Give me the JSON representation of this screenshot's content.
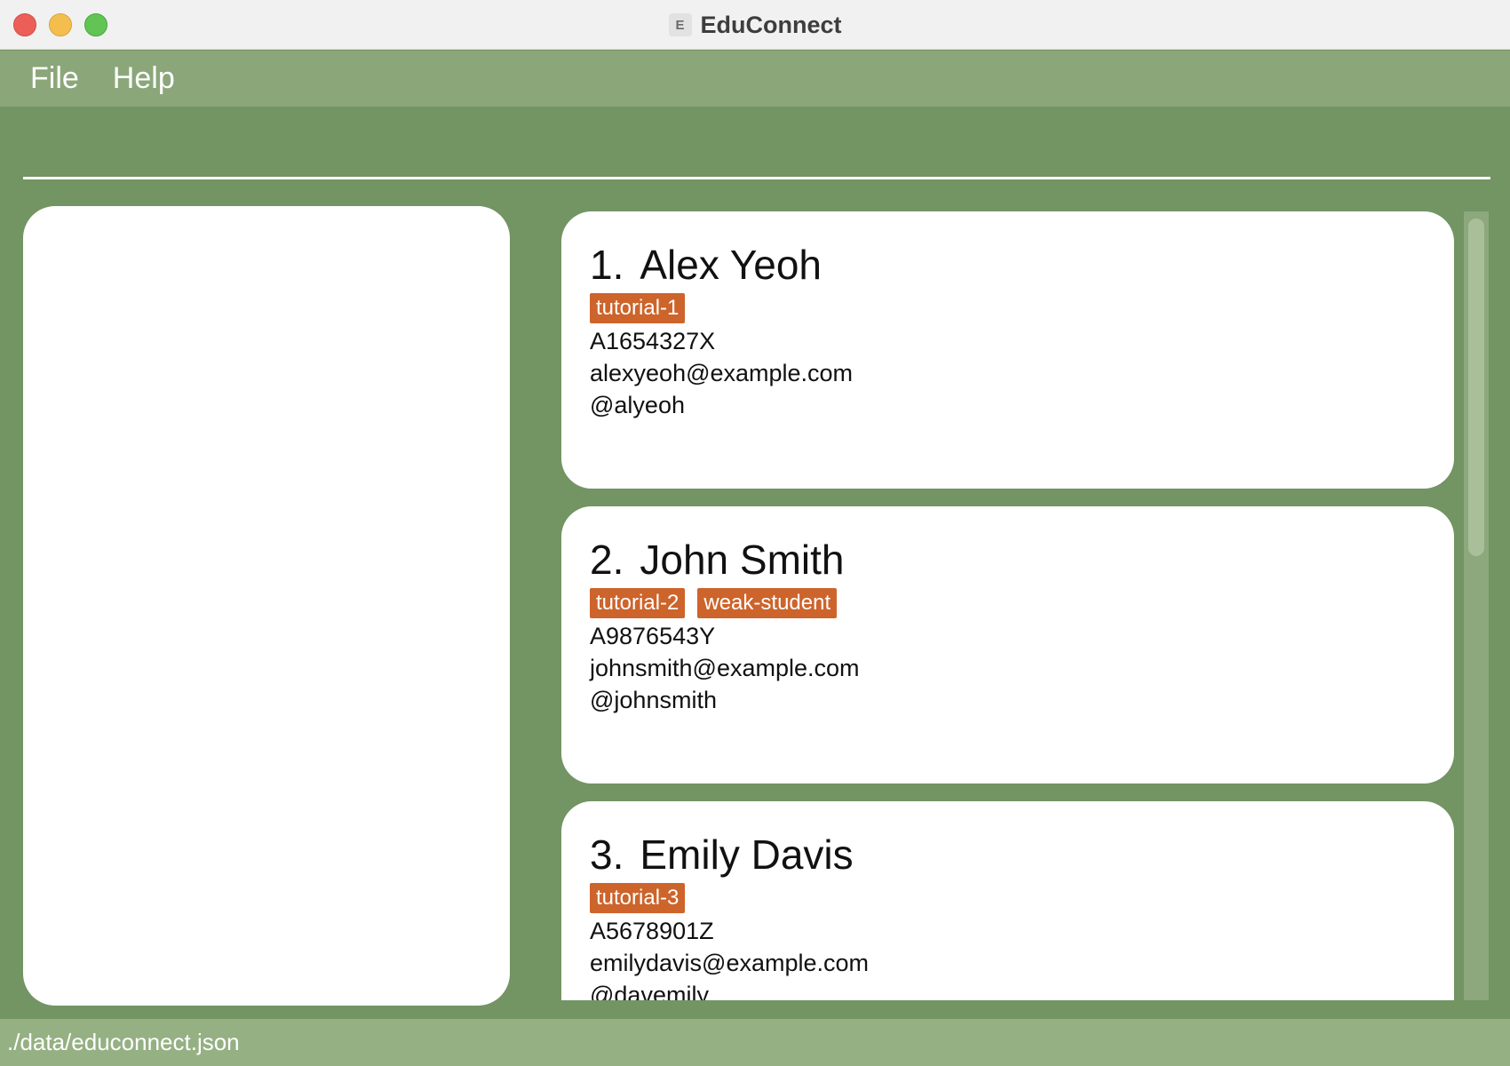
{
  "window": {
    "title": "EduConnect",
    "app_icon": "educonnect-icon"
  },
  "menu": {
    "file_label": "File",
    "help_label": "Help"
  },
  "command": {
    "value": "",
    "placeholder": ""
  },
  "result": {
    "text": ""
  },
  "persons": [
    {
      "index": "1.",
      "name": "Alex Yeoh",
      "tags": [
        "tutorial-1"
      ],
      "student_id": "A1654327X",
      "email": "alexyeoh@example.com",
      "telegram": "@alyeoh"
    },
    {
      "index": "2.",
      "name": "John Smith",
      "tags": [
        "tutorial-2",
        "weak-student"
      ],
      "student_id": "A9876543Y",
      "email": "johnsmith@example.com",
      "telegram": "@johnsmith"
    },
    {
      "index": "3.",
      "name": "Emily Davis",
      "tags": [
        "tutorial-3"
      ],
      "student_id": "A5678901Z",
      "email": "emilydavis@example.com",
      "telegram": "@davemily"
    }
  ],
  "status": {
    "file_path": "./data/educonnect.json"
  },
  "colors": {
    "background": "#739463",
    "menubar": "#8ba77a",
    "statusbar": "#95b083",
    "tag": "#cd642b"
  }
}
